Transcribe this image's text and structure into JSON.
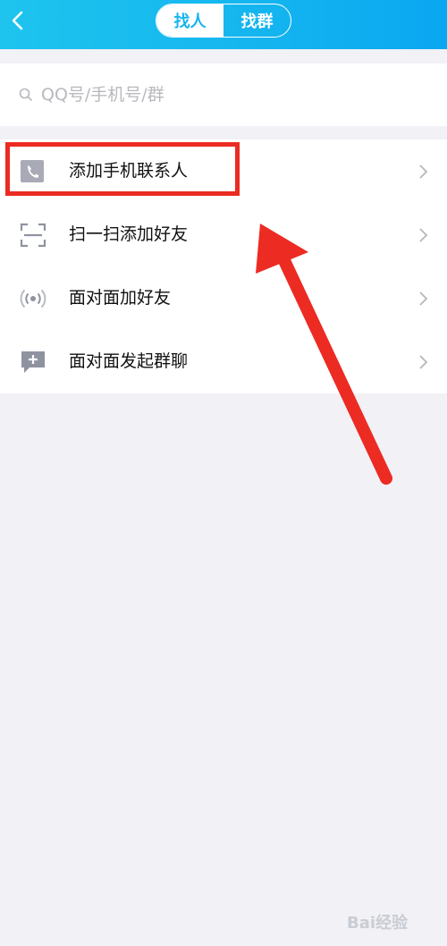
{
  "header": {
    "back_icon": "chevron-left-icon",
    "tabs": [
      {
        "label": "找人",
        "active": true
      },
      {
        "label": "找群",
        "active": false
      }
    ]
  },
  "search": {
    "placeholder": "QQ号/手机号/群",
    "icon": "search-icon"
  },
  "menu": {
    "items": [
      {
        "label": "添加手机联系人",
        "icon": "phone-icon"
      },
      {
        "label": "扫一扫添加好友",
        "icon": "scan-icon"
      },
      {
        "label": "面对面加好友",
        "icon": "radar-icon"
      },
      {
        "label": "面对面发起群聊",
        "icon": "chat-plus-icon"
      }
    ]
  },
  "annotation": {
    "highlight_color": "#ec2b22"
  },
  "watermark": {
    "text": "Bai经验"
  },
  "colors": {
    "header_start": "#1ec4ee",
    "header_end": "#0aa7f1",
    "background": "#f1f1f6"
  }
}
